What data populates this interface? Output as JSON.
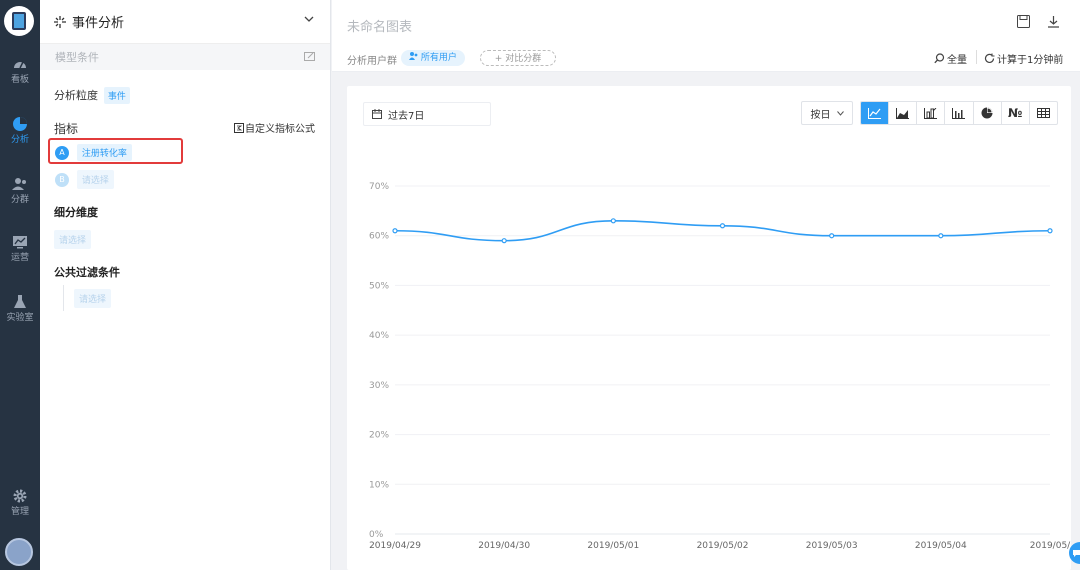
{
  "sidebar_nav": {
    "items": [
      {
        "label": "看板",
        "icon": "dashboard-icon"
      },
      {
        "label": "分析",
        "icon": "pie-chart-icon"
      },
      {
        "label": "分群",
        "icon": "users-icon"
      },
      {
        "label": "运营",
        "icon": "monitor-chart-icon"
      },
      {
        "label": "实验室",
        "icon": "flask-icon"
      }
    ],
    "bottom": {
      "label": "管理",
      "icon": "gear-icon"
    }
  },
  "panel": {
    "title": "事件分析",
    "model_condition": "模型条件",
    "granularity_label": "分析粒度",
    "granularity_value": "事件",
    "metrics_label": "指标",
    "custom_formula": "自定义指标公式",
    "metric_a_letter": "A",
    "metric_a": "注册转化率",
    "metric_b_letter": "B",
    "metric_b_placeholder": "请选择",
    "breakdown_label": "细分维度",
    "breakdown_placeholder": "请选择",
    "filter_label": "公共过滤条件",
    "filter_placeholder": "请选择"
  },
  "header": {
    "chart_name": "未命名图表",
    "segment_label": "分析用户群",
    "segment_value": "所有用户",
    "compare_segment": "+ 对比分群",
    "fullscreen": "全量",
    "computed": "计算于1分钟前"
  },
  "controls": {
    "date_range": "过去7日",
    "granularity": "按日",
    "chart_types": [
      "line",
      "area",
      "stacked",
      "bar",
      "pie",
      "number",
      "table"
    ],
    "number_glyph": "№"
  },
  "chart_data": {
    "type": "line",
    "x": [
      "2019/04/29",
      "2019/04/30",
      "2019/05/01",
      "2019/05/02",
      "2019/05/03",
      "2019/05/04",
      "2019/05/"
    ],
    "y_ticks": [
      "0%",
      "10%",
      "20%",
      "30%",
      "40%",
      "50%",
      "60%",
      "70%"
    ],
    "series": [
      {
        "values": [
          61,
          59,
          63,
          62,
          60,
          60,
          61
        ]
      }
    ],
    "ylim": [
      0,
      70
    ],
    "color": "#2f9df4",
    "grid": true
  }
}
